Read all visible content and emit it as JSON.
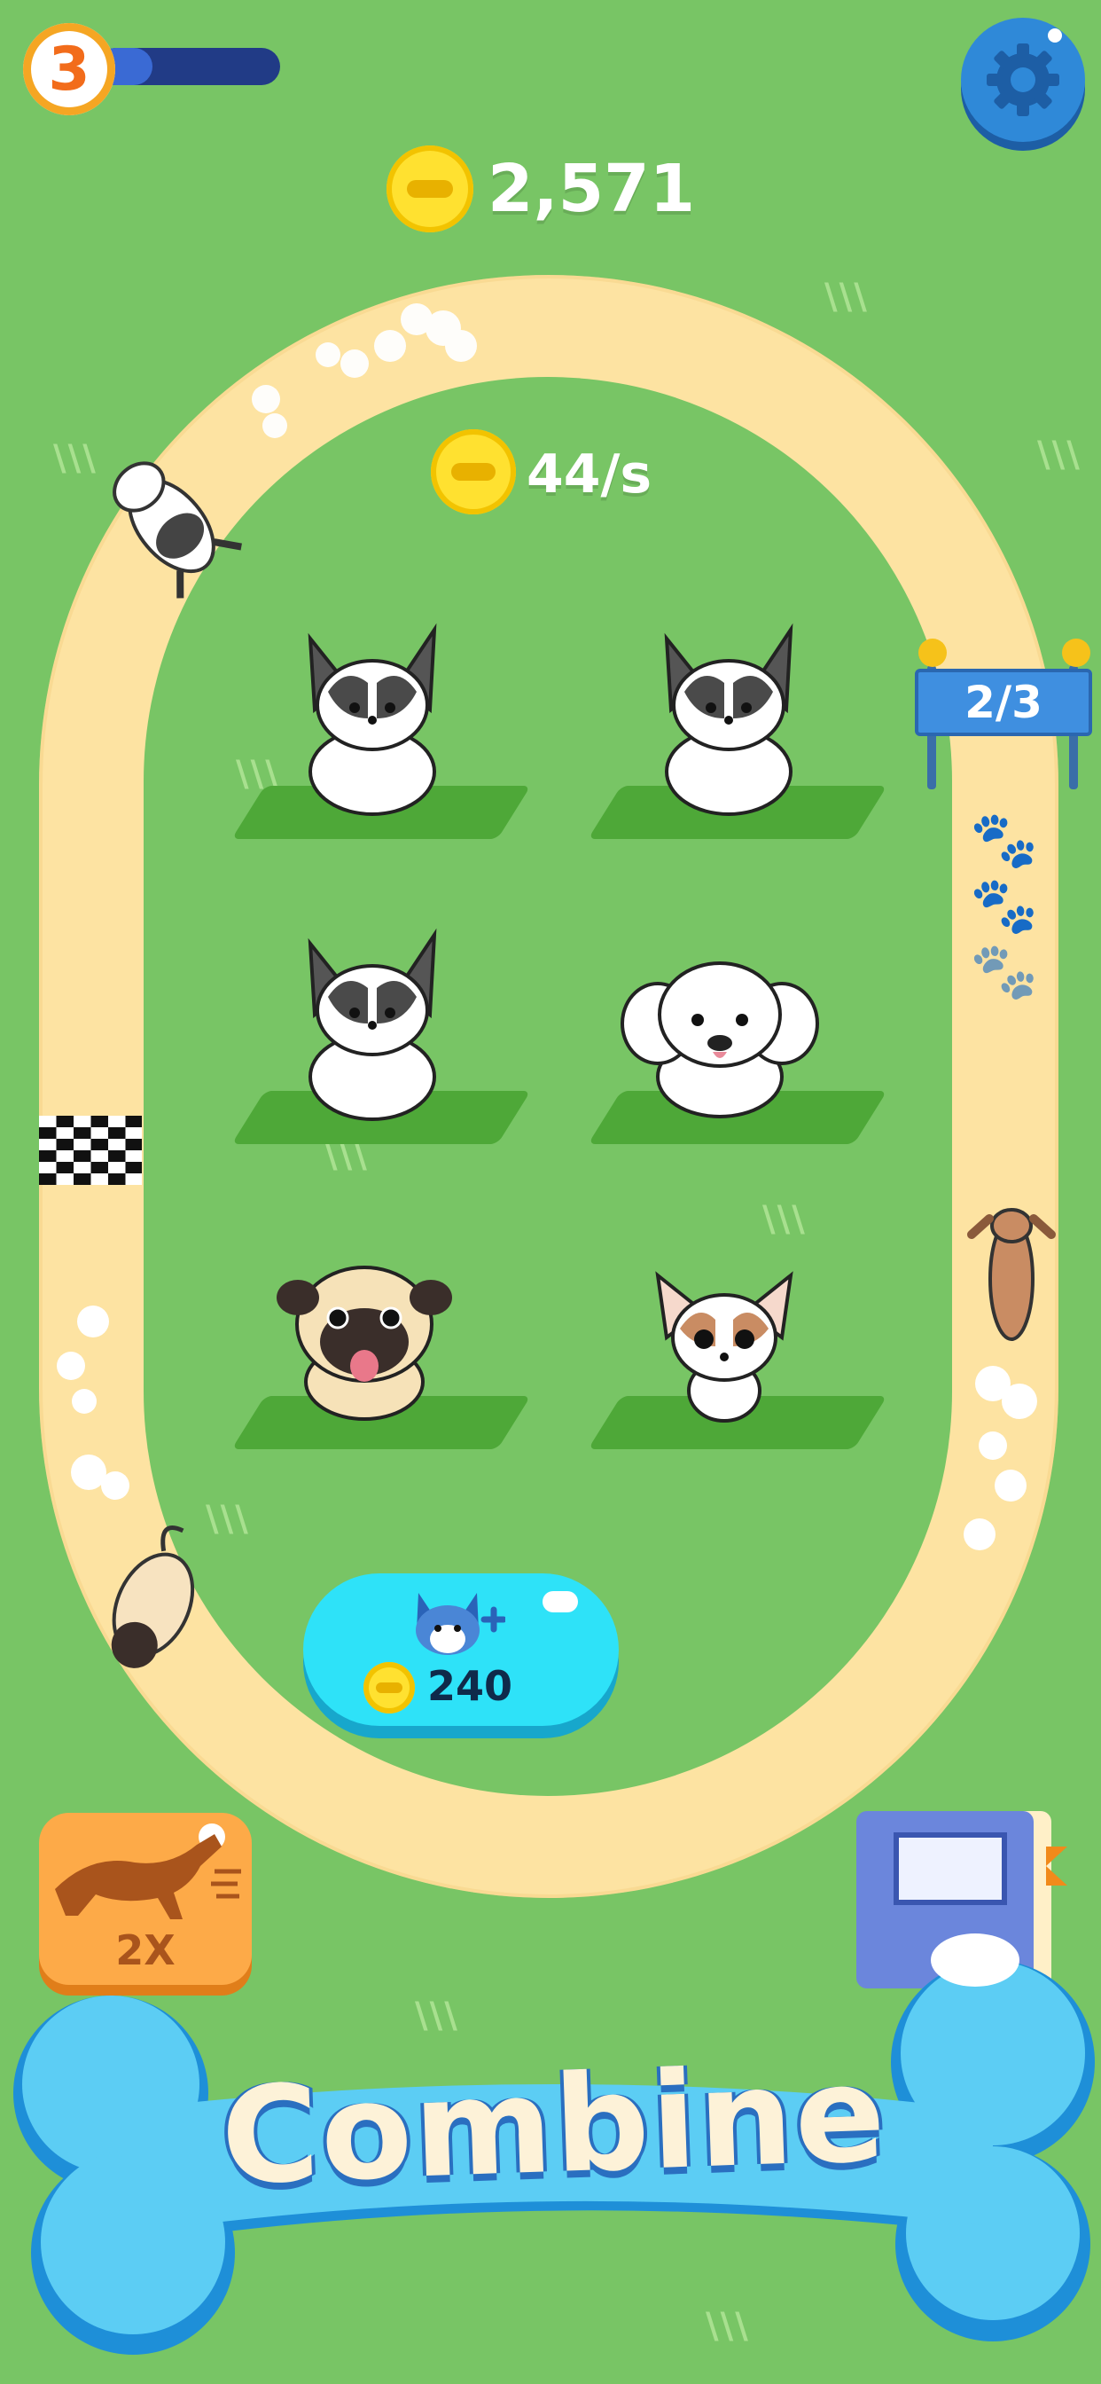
{
  "hud": {
    "level": "3",
    "coins": "2,571",
    "settings_icon": "gear-icon",
    "xp_progress": 0.3
  },
  "income": {
    "rate": "44/s",
    "coin_icon": "bone-coin-icon"
  },
  "track": {
    "lap_progress": "2/3",
    "finish_icon": "checkered-flag-icon",
    "paw_icon": "paw-icon"
  },
  "grid": {
    "slots": [
      {
        "breed": "papillon"
      },
      {
        "breed": "papillon"
      },
      {
        "breed": "papillon"
      },
      {
        "breed": "maltese"
      },
      {
        "breed": "pug"
      },
      {
        "breed": "chihuahua"
      }
    ]
  },
  "buy_dog": {
    "cost": "240",
    "icon": "husky-head-plus-icon"
  },
  "speed_boost": {
    "label": "2X",
    "icon": "running-dog-icon"
  },
  "book": {
    "icon": "dog-album-book-icon"
  },
  "combine": {
    "label": "Combine"
  },
  "colors": {
    "grass": "#78c565",
    "track": "#fde3a2",
    "accent_blue": "#2f89d8",
    "bone_blue": "#5ccdf4",
    "coin_yellow": "#ffe130"
  }
}
